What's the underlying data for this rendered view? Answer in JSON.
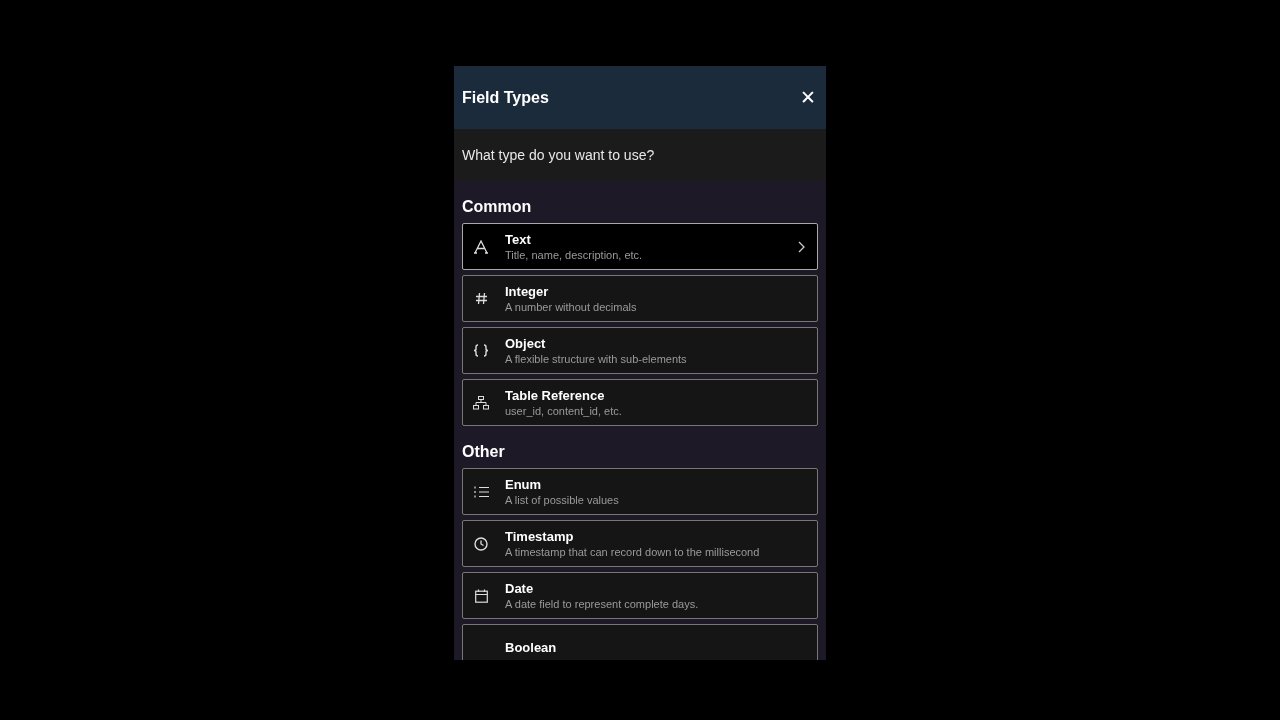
{
  "dialog": {
    "title": "Field Types",
    "close": "✕"
  },
  "prompt": "What type do you want to use?",
  "sections": [
    {
      "heading": "Common",
      "items": [
        {
          "kind": "text",
          "label": "Text",
          "description": "Title, name, description, etc.",
          "selected": true
        },
        {
          "kind": "hash",
          "label": "Integer",
          "description": "A number without decimals",
          "selected": false
        },
        {
          "kind": "braces",
          "label": "Object",
          "description": "A flexible structure with sub-elements",
          "selected": false
        },
        {
          "kind": "tree",
          "label": "Table Reference",
          "description": "user_id, content_id, etc.",
          "selected": false
        }
      ]
    },
    {
      "heading": "Other",
      "items": [
        {
          "kind": "list",
          "label": "Enum",
          "description": "A list of possible values",
          "selected": false
        },
        {
          "kind": "clock",
          "label": "Timestamp",
          "description": "A timestamp that can record down to the millisecond",
          "selected": false
        },
        {
          "kind": "calendar",
          "label": "Date",
          "description": "A date field to represent complete days.",
          "selected": false
        },
        {
          "kind": "unknown",
          "label": "Boolean",
          "selected": false
        }
      ]
    }
  ]
}
